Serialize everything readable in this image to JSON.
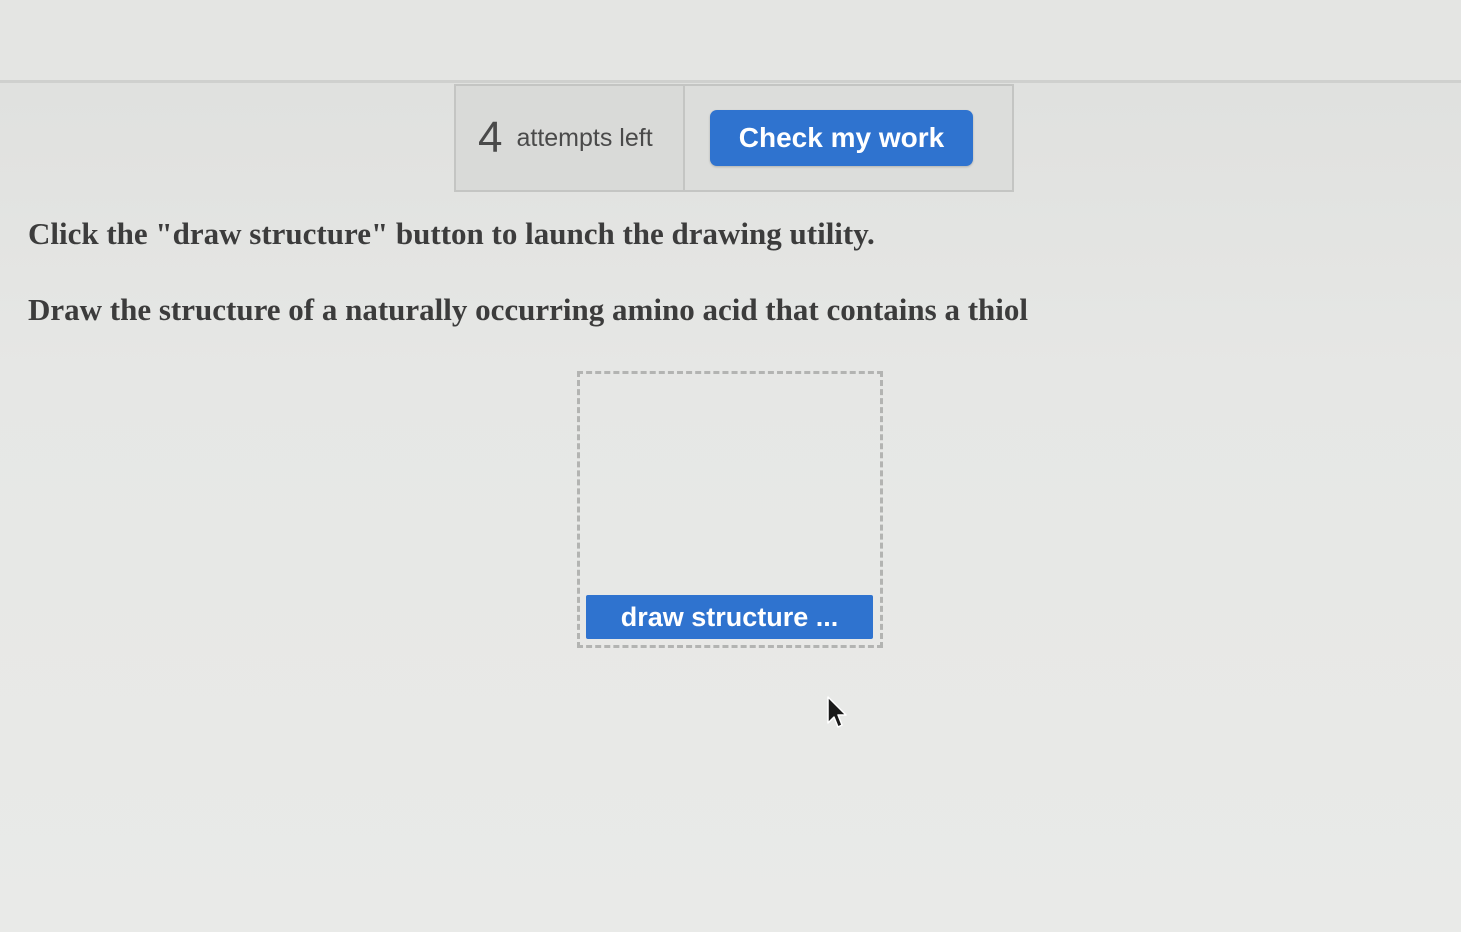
{
  "attempts": {
    "count": "4",
    "label": "attempts left"
  },
  "check_button_label": "Check my work",
  "instructions": {
    "line1": "Click the \"draw structure\" button to launch the drawing utility.",
    "line2": "Draw the structure of a naturally occurring amino acid that contains a thiol"
  },
  "draw_button_label": "draw structure ...",
  "colors": {
    "accent": "#2f73cf",
    "text": "#3c3c3c",
    "background": "#e6e7e5"
  },
  "icons": {
    "cursor": "mouse-pointer-icon"
  }
}
